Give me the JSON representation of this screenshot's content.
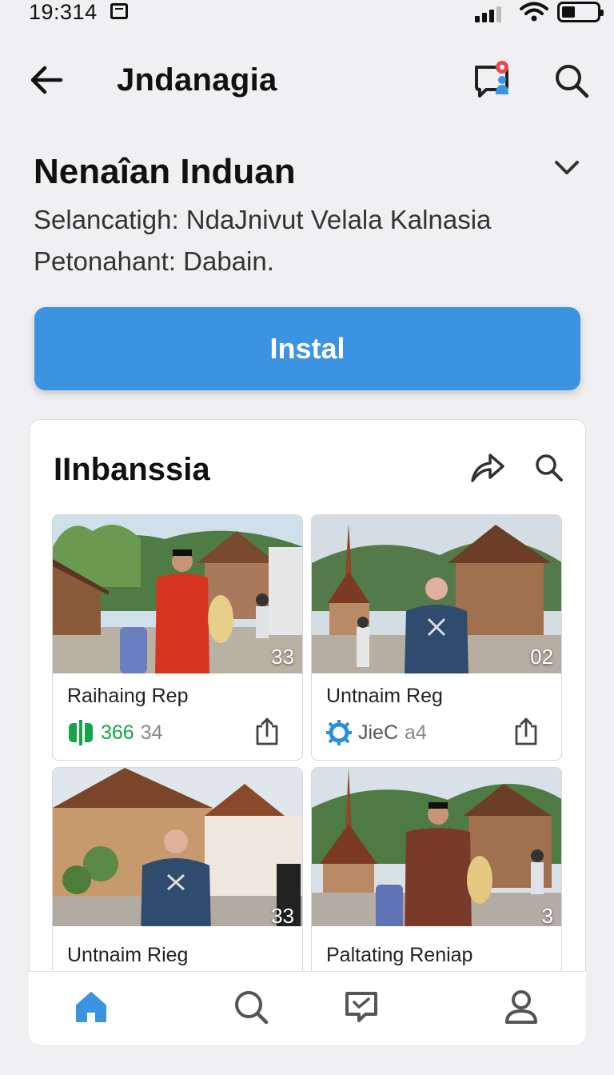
{
  "status_bar": {
    "time": "19:314"
  },
  "header": {
    "title": "Jndanagia"
  },
  "info": {
    "title": "Nenaîan Induan",
    "line1": "Selancatigh: NdaJnivut Velala Kalnasia",
    "line2": "Petonahant: Dabain."
  },
  "install_label": "Instal",
  "section": {
    "title": "IInbanssia",
    "tiles": [
      {
        "name": "Raihaing Rep",
        "badge": "33",
        "stat": "366",
        "stat_extra": "34",
        "stat_icon": "green-leaf-icon",
        "stat_color": "#16a34a"
      },
      {
        "name": "Untnaim Reg",
        "badge": "02",
        "stat": "JieC",
        "stat_extra": "a4",
        "stat_icon": "blue-gear-icon",
        "stat_color": "#555555"
      },
      {
        "name": "Untnaim Rieg",
        "badge": "33"
      },
      {
        "name": "Paltating Reniap",
        "badge": "3"
      }
    ]
  },
  "nav": [
    "home-icon",
    "search-icon",
    "chat-icon",
    "profile-icon"
  ],
  "colors": {
    "accent": "#3b93e2",
    "nav_active": "#3b93e2",
    "badge_red": "#e5484d"
  }
}
